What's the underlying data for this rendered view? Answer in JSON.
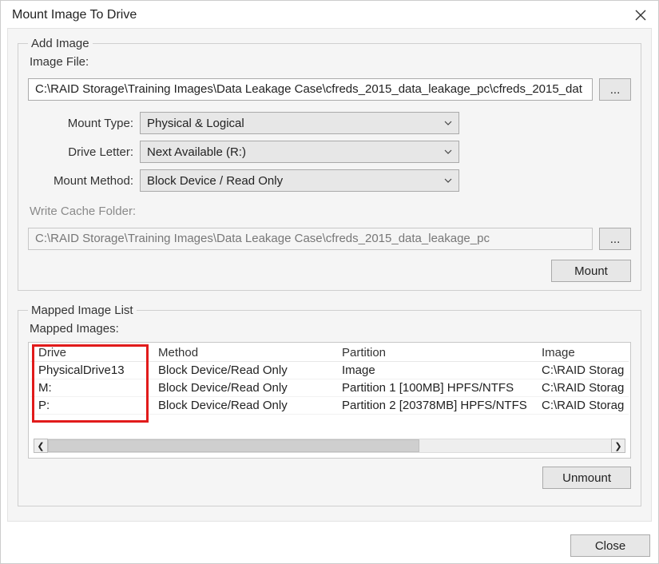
{
  "window": {
    "title": "Mount Image To Drive"
  },
  "add_image": {
    "legend": "Add Image",
    "image_file_label": "Image File:",
    "image_file_value": "C:\\RAID Storage\\Training Images\\Data Leakage Case\\cfreds_2015_data_leakage_pc\\cfreds_2015_dat",
    "browse_label": "...",
    "mount_type_label": "Mount Type:",
    "mount_type_value": "Physical & Logical",
    "drive_letter_label": "Drive Letter:",
    "drive_letter_value": "Next Available (R:)",
    "mount_method_label": "Mount Method:",
    "mount_method_value": "Block Device / Read Only",
    "write_cache_label": "Write Cache Folder:",
    "write_cache_value": "C:\\RAID Storage\\Training Images\\Data Leakage Case\\cfreds_2015_data_leakage_pc",
    "write_cache_browse_label": "...",
    "mount_button": "Mount"
  },
  "mapped": {
    "legend": "Mapped Image List",
    "list_label": "Mapped Images:",
    "columns": {
      "drive": "Drive",
      "method": "Method",
      "partition": "Partition",
      "image": "Image"
    },
    "rows": [
      {
        "drive": "PhysicalDrive13",
        "method": "Block Device/Read Only",
        "partition": "Image",
        "image": "C:\\RAID Storag"
      },
      {
        "drive": "M:",
        "method": "Block Device/Read Only",
        "partition": "Partition 1 [100MB] HPFS/NTFS",
        "image": "C:\\RAID Storag"
      },
      {
        "drive": "P:",
        "method": "Block Device/Read Only",
        "partition": "Partition 2 [20378MB] HPFS/NTFS",
        "image": "C:\\RAID Storag"
      }
    ],
    "unmount_button": "Unmount"
  },
  "footer": {
    "close_button": "Close"
  },
  "scroll": {
    "left_glyph": "❮",
    "right_glyph": "❯"
  }
}
